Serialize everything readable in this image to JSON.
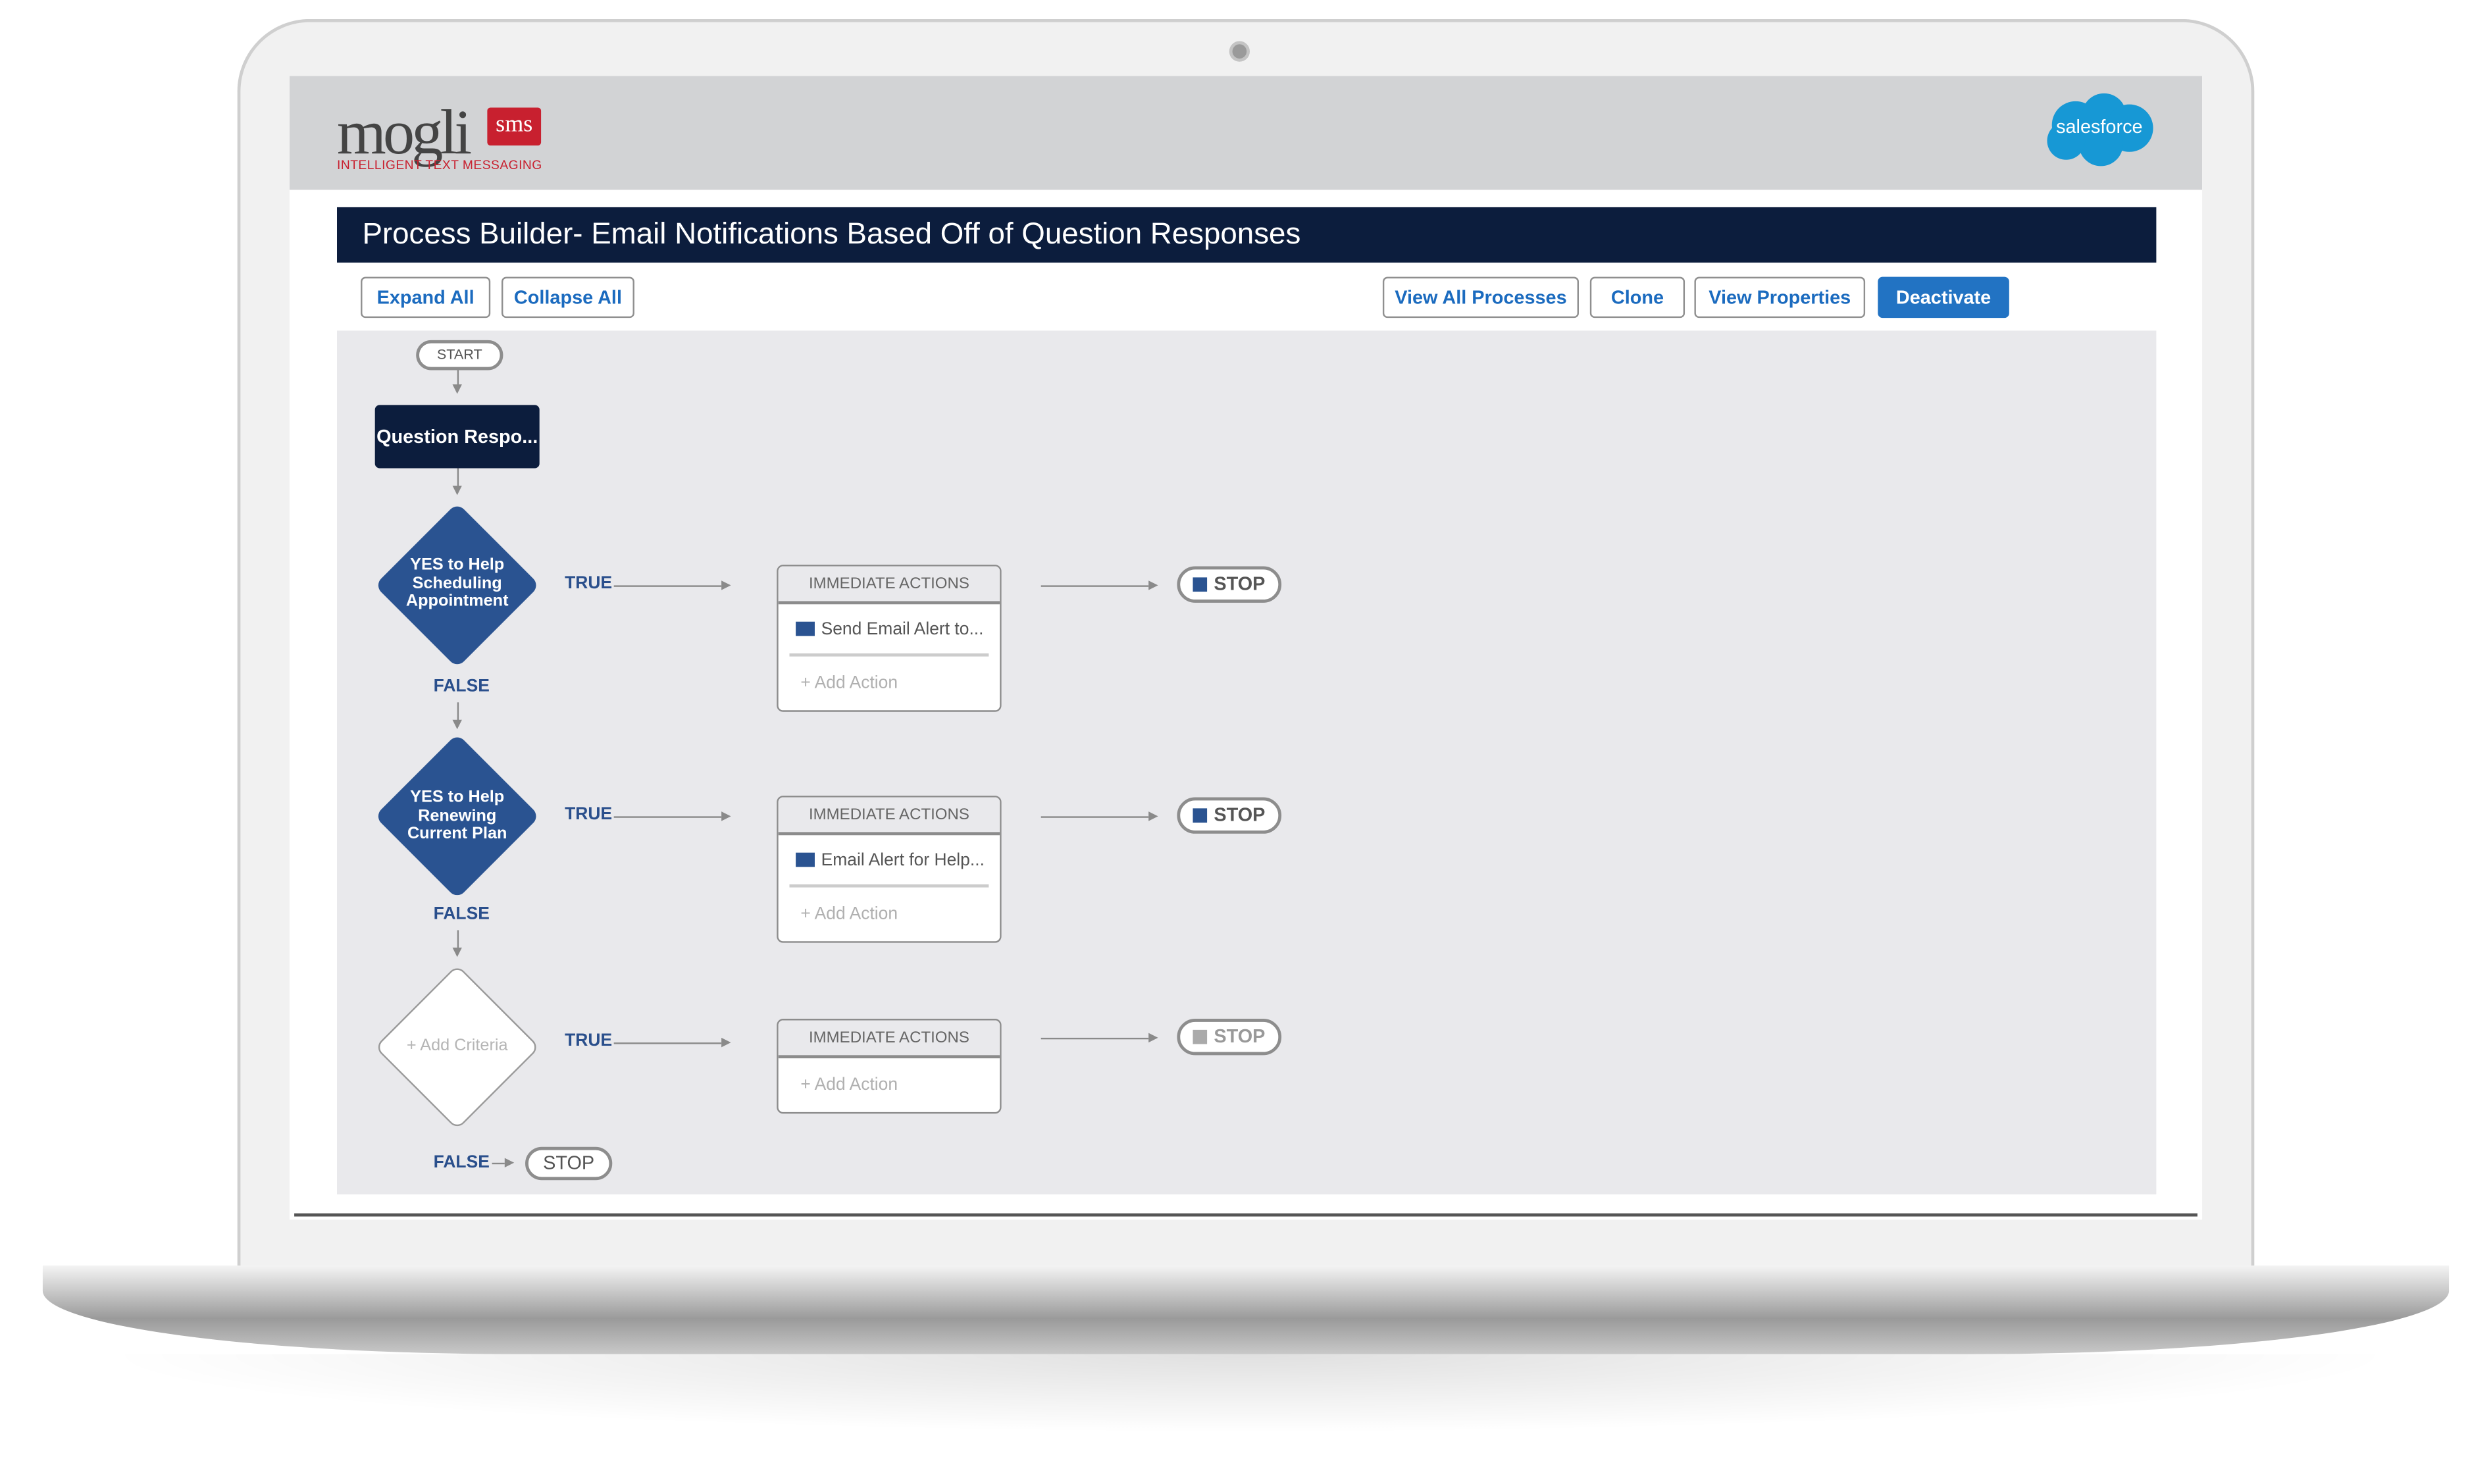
{
  "brand": {
    "logo_text": "mogli",
    "logo_badge": "sms",
    "tagline": "INTELLIGENT TEXT MESSAGING",
    "partner": "salesforce"
  },
  "header": {
    "title": "Process Builder- Email Notifications Based Off of Question Responses"
  },
  "toolbar": {
    "expand_all": "Expand All",
    "collapse_all": "Collapse  All",
    "view_all_processes": "View  All Processes",
    "clone": "Clone",
    "view_properties": "View  Properties",
    "deactivate": "Deactivate"
  },
  "colors": {
    "navy": "#0c1d3d",
    "accent": "#2273c3",
    "diamond": "#2a5391",
    "canvas": "#e9e9ec"
  },
  "flow": {
    "start": "START",
    "object_node": "Question Respo...",
    "criteria": [
      {
        "label": "YES to Help Scheduling Appointment",
        "true_label": "TRUE",
        "false_label": "FALSE",
        "actions_header": "IMMEDIATE ACTIONS",
        "action": "Send Email Alert to...",
        "add_action": "Add Action",
        "stop": "STOP"
      },
      {
        "label": "YES to Help Renewing Current Plan",
        "true_label": "TRUE",
        "false_label": "FALSE",
        "actions_header": "IMMEDIATE ACTIONS",
        "action": "Email Alert for Help...",
        "add_action": "Add Action",
        "stop": "STOP"
      },
      {
        "label": "Add Criteria",
        "true_label": "TRUE",
        "false_label": "FALSE",
        "actions_header": "IMMEDIATE ACTIONS",
        "add_action": "Add Action",
        "stop": "STOP"
      }
    ],
    "final_stop": "STOP"
  }
}
